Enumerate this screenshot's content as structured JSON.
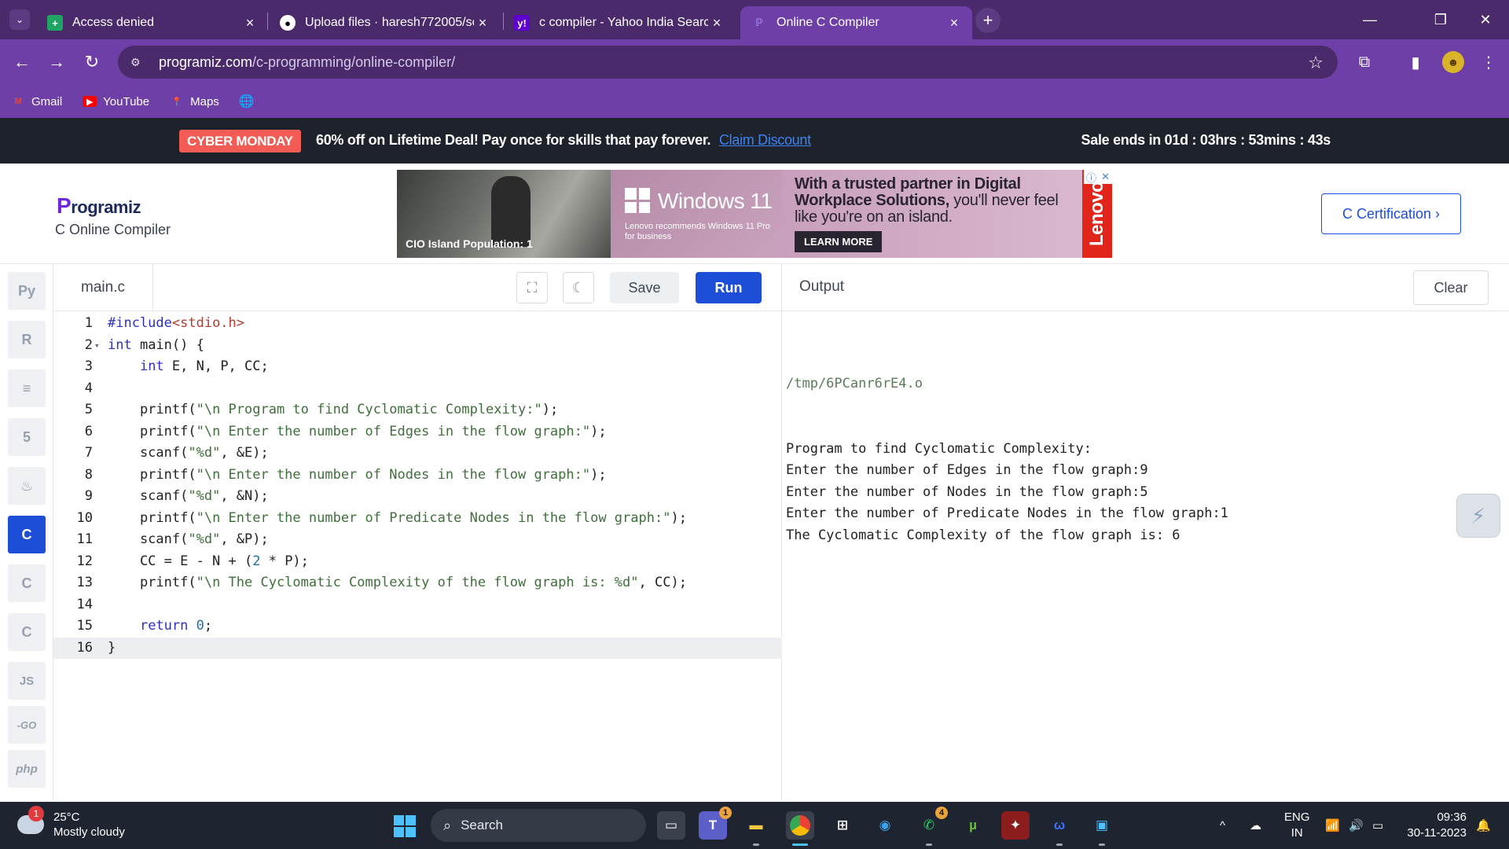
{
  "browser": {
    "tabs": [
      {
        "title": "Access denied",
        "icon": "sheets-icon"
      },
      {
        "title": "Upload files · haresh772005/sof",
        "icon": "github-icon"
      },
      {
        "title": "c compiler - Yahoo India Search",
        "icon": "yahoo-icon"
      },
      {
        "title": "Online C Compiler",
        "icon": "programiz-icon",
        "active": true
      }
    ],
    "url_domain": "programiz.com",
    "url_path": "/c-programming/online-compiler/",
    "bookmarks": [
      {
        "label": "Gmail",
        "icon": "gmail-icon"
      },
      {
        "label": "YouTube",
        "icon": "youtube-icon"
      },
      {
        "label": "Maps",
        "icon": "maps-icon"
      }
    ]
  },
  "promo": {
    "badge": "CYBER MONDAY",
    "text": "60% off on Lifetime Deal! Pay once for skills that pay forever.",
    "link": "Claim Discount",
    "timer": "Sale ends in 01d : 03hrs : 53mins : 43s"
  },
  "header": {
    "logo": "Programiz",
    "subtitle": "C Online Compiler",
    "cert_button": "C Certification ›",
    "ad": {
      "caption": "CIO Island Population: 1",
      "product": "Windows 11",
      "recommend": "Lenovo recommends Windows 11 Pro for business",
      "headline_bold": "With a trusted partner in Digital Workplace Solutions,",
      "headline": "you'll never feel like you're on an island.",
      "cta": "LEARN MORE",
      "brand": "Lenovo"
    }
  },
  "languages": [
    {
      "name": "python",
      "label": "Py"
    },
    {
      "name": "r",
      "label": "R"
    },
    {
      "name": "sql",
      "label": "≡"
    },
    {
      "name": "html",
      "label": "5"
    },
    {
      "name": "java",
      "label": "♨"
    },
    {
      "name": "c",
      "label": "C",
      "active": true
    },
    {
      "name": "cpp",
      "label": "C"
    },
    {
      "name": "csharp",
      "label": "C"
    },
    {
      "name": "js",
      "label": "JS"
    },
    {
      "name": "go",
      "label": "-GO"
    },
    {
      "name": "php",
      "label": "php"
    }
  ],
  "editor": {
    "file_name": "main.c",
    "save_label": "Save",
    "run_label": "Run",
    "lines": [
      "#include<stdio.h>",
      "int main() {",
      "    int E, N, P, CC;",
      "",
      "    printf(\"\\n Program to find Cyclomatic Complexity:\");",
      "    printf(\"\\n Enter the number of Edges in the flow graph:\");",
      "    scanf(\"%d\", &E);",
      "    printf(\"\\n Enter the number of Nodes in the flow graph:\");",
      "    scanf(\"%d\", &N);",
      "    printf(\"\\n Enter the number of Predicate Nodes in the flow graph:\");",
      "    scanf(\"%d\", &P);",
      "    CC = E - N + (2 * P);",
      "    printf(\"\\n The Cyclomatic Complexity of the flow graph is: %d\", CC);",
      "",
      "    return 0;",
      "}"
    ]
  },
  "output": {
    "title": "Output",
    "clear_label": "Clear",
    "path": "/tmp/6PCanr6rE4.o",
    "lines": [
      "Program to find Cyclomatic Complexity:",
      "Enter the number of Edges in the flow graph:9",
      "Enter the number of Nodes in the flow graph:5",
      "Enter the number of Predicate Nodes in the flow graph:1",
      "The Cyclomatic Complexity of the flow graph is: 6"
    ]
  },
  "taskbar": {
    "temperature": "25°C",
    "weather": "Mostly cloudy",
    "weather_badge": "1",
    "search_placeholder": "Search",
    "teams_badge": "1",
    "whatsapp_badge": "4",
    "lang_top": "ENG",
    "lang_bottom": "IN",
    "time": "09:36",
    "date": "30-11-2023"
  }
}
